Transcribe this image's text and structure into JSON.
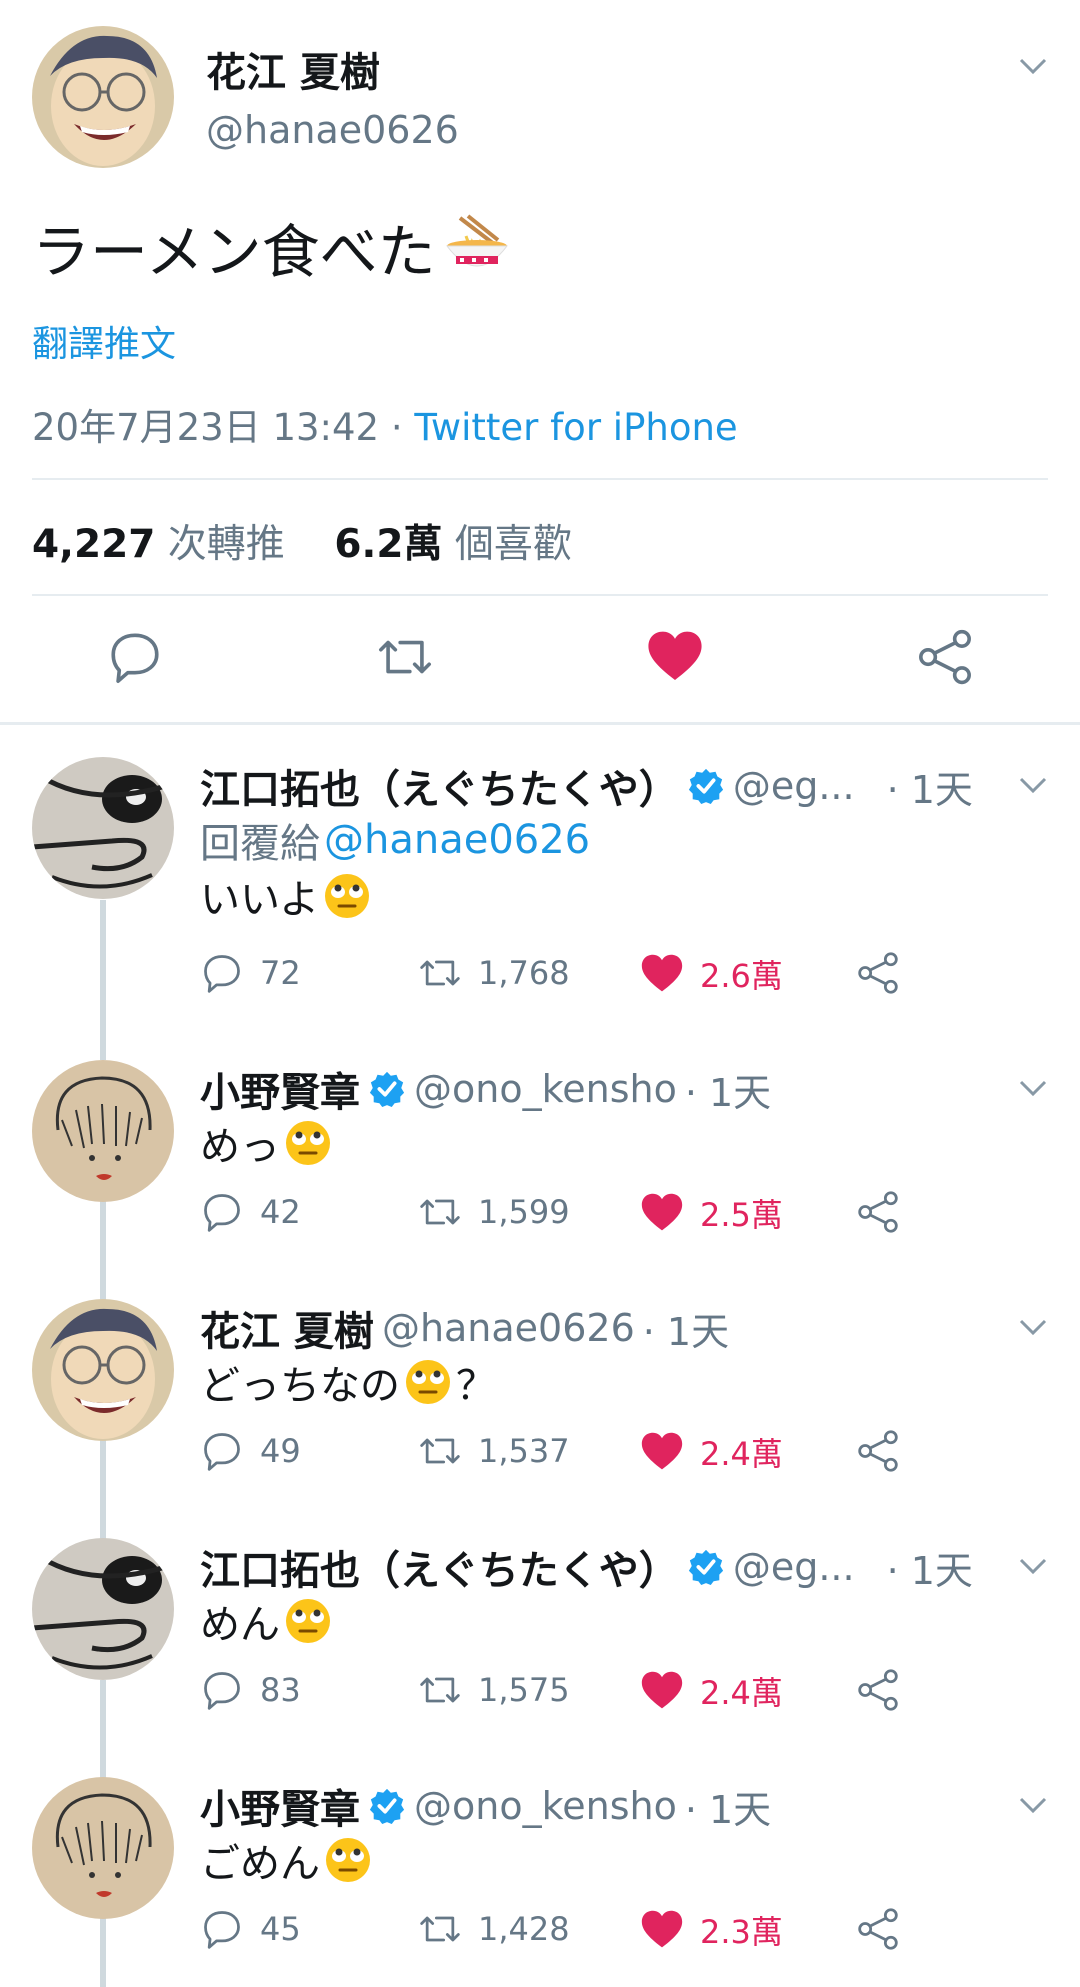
{
  "main_tweet": {
    "name": "花江 夏樹",
    "handle": "@hanae0626",
    "text": "ラーメン食べた",
    "text_emoji": "ramen-emoji",
    "translate_label": "翻譯推文",
    "date": "20年7月23日 13:42 · ",
    "source": "Twitter for iPhone",
    "retweets_count": "4,227",
    "retweets_label": "次轉推",
    "likes_count": "6.2萬",
    "likes_label": "個喜歡",
    "liked": true
  },
  "replies": [
    {
      "name": "江口拓也（えぐちたくや）",
      "verified": true,
      "handle": "@eg...",
      "time": "· 1天",
      "reply_to_label": "回覆給",
      "reply_to": "@hanae0626",
      "text": "いいよ",
      "emoji": "rolling-eyes-emoji",
      "comments": "72",
      "retweets": "1,768",
      "likes": "2.6萬"
    },
    {
      "name": "小野賢章",
      "verified": true,
      "handle": "@ono_kensho",
      "time": "· 1天",
      "text": "めっ",
      "emoji": "rolling-eyes-emoji",
      "comments": "42",
      "retweets": "1,599",
      "likes": "2.5萬"
    },
    {
      "name": "花江 夏樹",
      "verified": false,
      "handle": "@hanae0626",
      "time": "· 1天",
      "text": "どっちなの",
      "text_after": "？",
      "emoji": "rolling-eyes-emoji",
      "comments": "49",
      "retweets": "1,537",
      "likes": "2.4萬"
    },
    {
      "name": "江口拓也（えぐちたくや）",
      "verified": true,
      "handle": "@eg...",
      "time": "· 1天",
      "text": "めん",
      "emoji": "rolling-eyes-emoji",
      "comments": "83",
      "retweets": "1,575",
      "likes": "2.4萬"
    },
    {
      "name": "小野賢章",
      "verified": true,
      "handle": "@ono_kensho",
      "time": "· 1天",
      "text": "ごめん",
      "emoji": "rolling-eyes-emoji",
      "comments": "45",
      "retweets": "1,428",
      "likes": "2.3萬"
    }
  ],
  "colors": {
    "link": "#1b95e0",
    "like": "#e0245e",
    "muted": "#657786",
    "verified": "#1da1f2"
  }
}
